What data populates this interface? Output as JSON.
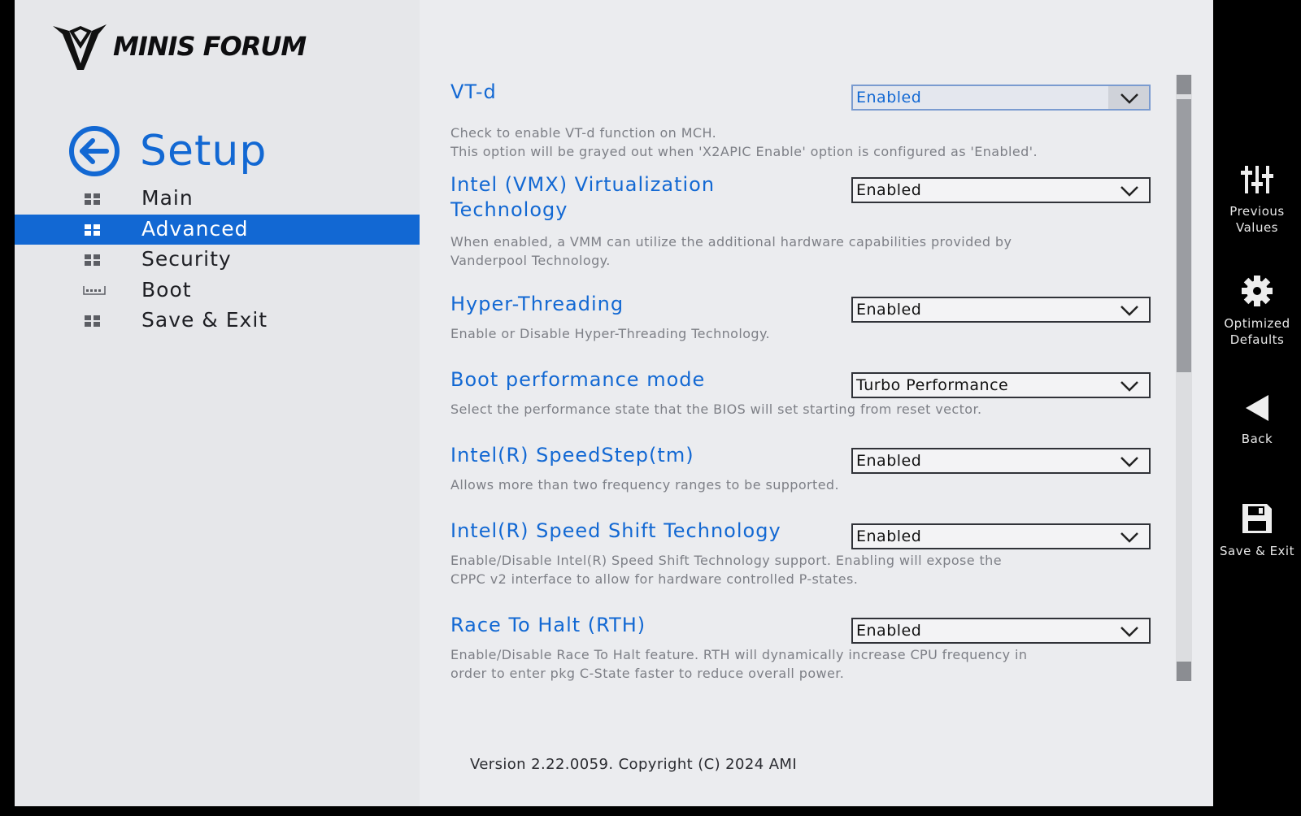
{
  "brand": {
    "name": "MINIS FORUM"
  },
  "header": {
    "title": "Setup"
  },
  "nav": {
    "items": [
      {
        "label": "Main",
        "active": false
      },
      {
        "label": "Advanced",
        "active": true
      },
      {
        "label": "Security",
        "active": false
      },
      {
        "label": "Boot",
        "active": false
      },
      {
        "label": "Save & Exit",
        "active": false
      }
    ]
  },
  "settings": [
    {
      "title": "VT-d",
      "value": "Enabled",
      "description": [
        "Check to enable VT-d function on MCH.",
        "This option will be grayed out when 'X2APIC Enable' option is configured as 'Enabled'."
      ],
      "focused": true
    },
    {
      "title": "Intel (VMX) Virtualization Technology",
      "value": "Enabled",
      "description": [
        "When enabled, a VMM can utilize the additional hardware capabilities provided by",
        "Vanderpool Technology."
      ]
    },
    {
      "title": "Hyper-Threading",
      "value": "Enabled",
      "description": [
        "Enable or Disable Hyper-Threading Technology."
      ]
    },
    {
      "title": "Boot performance mode",
      "value": "Turbo Performance",
      "description": [
        "Select the performance state that the BIOS will set starting from reset vector."
      ]
    },
    {
      "title": "Intel(R) SpeedStep(tm)",
      "value": "Enabled",
      "description": [
        "Allows more than two frequency ranges to be supported."
      ]
    },
    {
      "title": "Intel(R) Speed Shift Technology",
      "value": "Enabled",
      "description": [
        "Enable/Disable Intel(R) Speed Shift Technology support. Enabling will expose the",
        "CPPC v2 interface to allow for hardware controlled P-states."
      ]
    },
    {
      "title": "Race To Halt (RTH)",
      "value": "Enabled",
      "description": [
        "Enable/Disable Race To Halt feature. RTH will dynamically increase CPU frequency in",
        "order to enter pkg C-State faster to reduce overall power."
      ]
    }
  ],
  "footer": {
    "version": "Version 2.22.0059. Copyright (C) 2024 AMI"
  },
  "side_buttons": [
    {
      "label_lines": [
        "Previous",
        "Values"
      ],
      "icon": "sliders-icon"
    },
    {
      "label_lines": [
        "Optimized",
        "Defaults"
      ],
      "icon": "gear-icon"
    },
    {
      "label_lines": [
        "Back"
      ],
      "icon": "back-triangle-icon"
    },
    {
      "label_lines": [
        "Save & Exit"
      ],
      "icon": "floppy-disk-icon"
    }
  ],
  "colors": {
    "accent": "#1268d3",
    "panel_bg": "#ebecef",
    "side_bg": "#000000",
    "desc_text": "#7d7f86"
  }
}
